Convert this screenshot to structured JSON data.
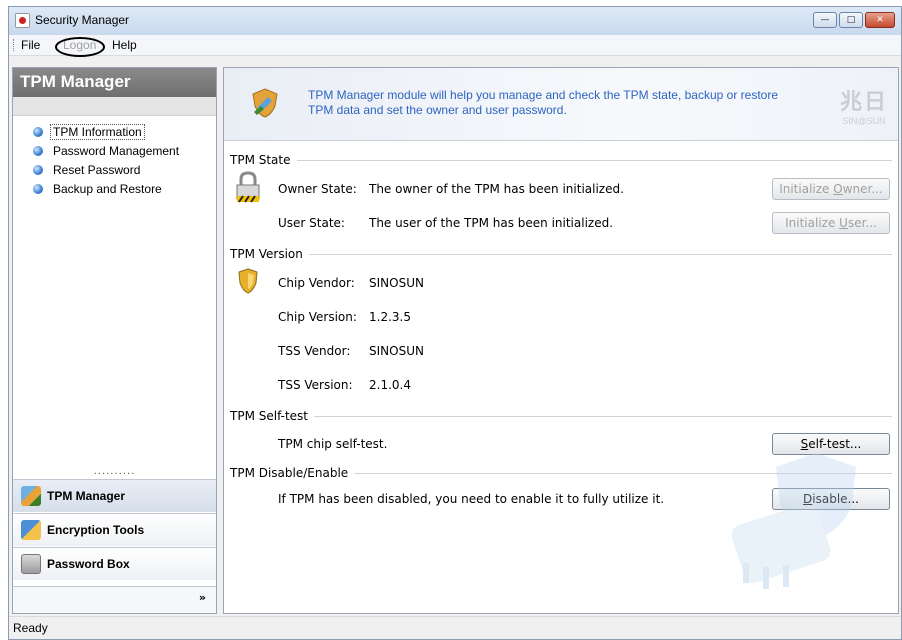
{
  "window": {
    "title": "Security Manager"
  },
  "menu": {
    "file": "File",
    "logon": "Logon",
    "help": "Help"
  },
  "sidebar": {
    "header": "TPM Manager",
    "items": [
      {
        "label": "TPM Information",
        "selected": true
      },
      {
        "label": "Password Management"
      },
      {
        "label": "Reset Password"
      },
      {
        "label": "Backup and Restore"
      }
    ],
    "grip": "..........",
    "sections": [
      {
        "label": "TPM Manager",
        "icon": "tpm-manager-icon"
      },
      {
        "label": "Encryption Tools",
        "icon": "encryption-tools-icon"
      },
      {
        "label": "Password Box",
        "icon": "password-box-icon"
      }
    ],
    "more": "»"
  },
  "banner": {
    "text": "TPM Manager module will help you manage and check the TPM state, backup or restore TPM data and set the owner and user password.",
    "logo_cn": "兆日",
    "logo_en": "SIN@SUN"
  },
  "tpm_state": {
    "label": "TPM State",
    "owner_label": "Owner State:",
    "owner_value": "The owner of the TPM has been initialized.",
    "owner_button": "Initialize Owner...",
    "user_label": "User State:",
    "user_value": "The user of the TPM has been initialized.",
    "user_button": "Initialize User..."
  },
  "tpm_version": {
    "label": "TPM Version",
    "chip_vendor_label": "Chip Vendor:",
    "chip_vendor": "SINOSUN",
    "chip_version_label": "Chip Version:",
    "chip_version": "1.2.3.5",
    "tss_vendor_label": "TSS Vendor:",
    "tss_vendor": "SINOSUN",
    "tss_version_label": "TSS Version:",
    "tss_version": "2.1.0.4"
  },
  "self_test": {
    "label": "TPM Self-test",
    "text": "TPM chip self-test.",
    "button": "Self-test..."
  },
  "disable_enable": {
    "label": "TPM Disable/Enable",
    "text": "If TPM has been disabled, you need to enable it to fully utilize it.",
    "button": "Disable..."
  },
  "status": {
    "text": "Ready"
  }
}
